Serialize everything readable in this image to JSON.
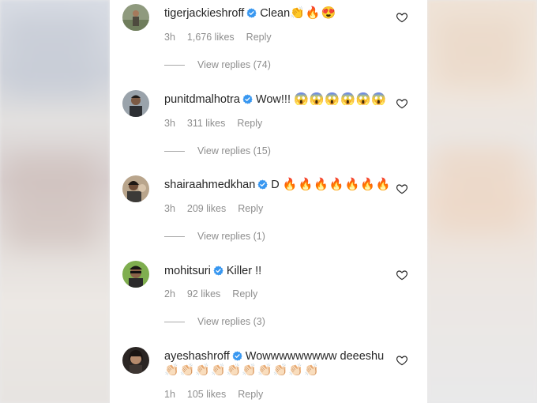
{
  "comments": [
    {
      "username": "tigerjackieshroff",
      "text": "Clean",
      "emoji": "👏🔥😍",
      "time": "3h",
      "likes": "1,676 likes",
      "reply": "Reply",
      "view_replies": "View replies (74)"
    },
    {
      "username": "punitdmalhotra",
      "text": "Wow!!!",
      "emoji": "😱😱😱😱😱😱",
      "time": "3h",
      "likes": "311 likes",
      "reply": "Reply",
      "view_replies": "View replies (15)"
    },
    {
      "username": "shairaahmedkhan",
      "text": "D",
      "emoji": "🔥🔥🔥🔥🔥🔥🔥",
      "time": "3h",
      "likes": "209 likes",
      "reply": "Reply",
      "view_replies": "View replies (1)"
    },
    {
      "username": "mohitsuri",
      "text": "Killer !!",
      "emoji": "",
      "time": "2h",
      "likes": "92 likes",
      "reply": "Reply",
      "view_replies": "View replies (3)"
    },
    {
      "username": "ayeshashroff",
      "text": "Wowwwwwwwww deeeshu",
      "emoji": "👏🏻👏🏻👏🏻👏🏻👏🏻👏🏻👏🏻👏🏻👏🏻👏🏻",
      "time": "1h",
      "likes": "105 likes",
      "reply": "Reply",
      "view_replies": ""
    }
  ],
  "colors": {
    "verified": "#3897f0",
    "meta_text": "#8e8e8e",
    "primary_text": "#262626"
  },
  "icons": {
    "verified": "verified-badge-icon",
    "like": "heart-outline-icon"
  }
}
